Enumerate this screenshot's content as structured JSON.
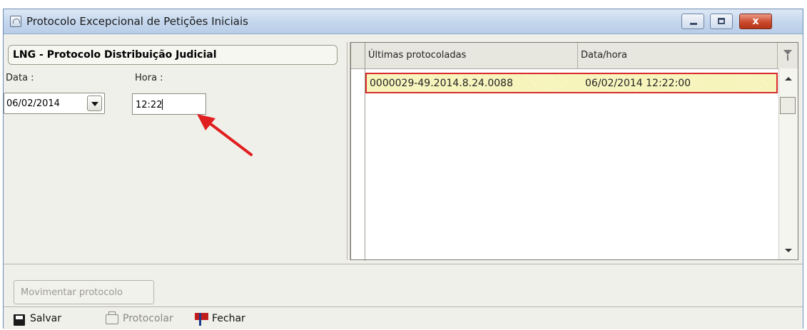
{
  "window": {
    "title": "Protocolo Excepcional de Petições Iniciais",
    "close_label": "x"
  },
  "left": {
    "group_title": "LNG - Protocolo Distribuição Judicial",
    "data_label": "Data :",
    "data_value": "06/02/2014",
    "hora_label": "Hora :",
    "hora_value": "12:22"
  },
  "grid": {
    "columns": [
      "Últimas protocoladas",
      "Data/hora"
    ],
    "rows": [
      {
        "protocolo": "0000029-49.2014.8.24.0088",
        "data_hora": "06/02/2014  12:22:00"
      }
    ]
  },
  "buttons": {
    "movimentar": "Movimentar protocolo"
  },
  "toolbar": {
    "salvar": "Salvar",
    "protocolar": "Protocolar",
    "fechar": "Fechar"
  },
  "colors": {
    "highlight_border": "#d82c2c",
    "selected_row": "#f3f0a6",
    "annotation_arrow": "#e02020"
  }
}
